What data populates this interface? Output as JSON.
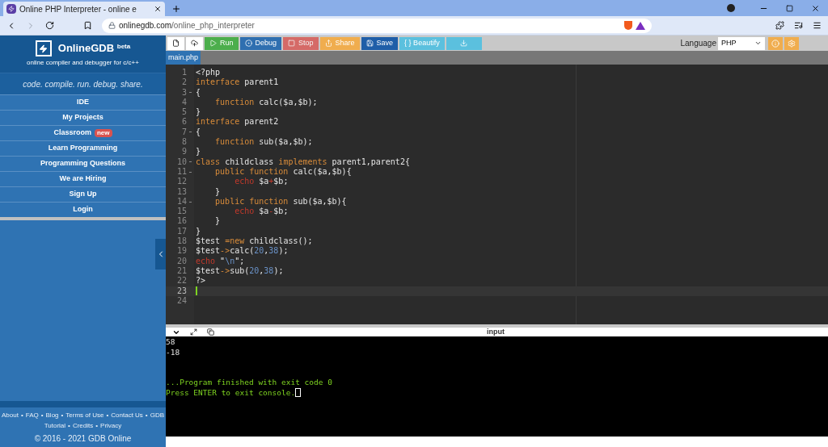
{
  "browser": {
    "tab_title": "Online PHP Interpreter - online e",
    "url_domain": "onlinegdb.com",
    "url_path": "/online_php_interpreter"
  },
  "sidebar": {
    "brand": "OnlineGDB",
    "brand_tag": "beta",
    "subtitle": "online compiler and debugger for c/c++",
    "tagline": "code. compile. run. debug. share.",
    "menu": [
      {
        "label": "IDE"
      },
      {
        "label": "My Projects"
      },
      {
        "label": "Classroom",
        "badge": "new"
      },
      {
        "label": "Learn Programming"
      },
      {
        "label": "Programming Questions"
      },
      {
        "label": "We are Hiring"
      },
      {
        "label": "Sign Up"
      },
      {
        "label": "Login"
      }
    ],
    "footer_separator": "•",
    "footer_rows": [
      [
        "About",
        "FAQ",
        "Blog",
        "Terms of Use",
        "Contact Us",
        "GDB"
      ],
      [
        "Tutorial",
        "Credits",
        "Privacy"
      ]
    ],
    "copyright": "© 2016 - 2021 GDB Online"
  },
  "toolbar": {
    "buttons": [
      {
        "kind": "new",
        "disabled": false
      },
      {
        "kind": "upload",
        "disabled": false
      },
      {
        "kind": "run",
        "label": "Run",
        "disabled": false
      },
      {
        "kind": "debug",
        "label": "Debug",
        "disabled": false
      },
      {
        "kind": "stop",
        "label": "Stop",
        "disabled": true
      },
      {
        "kind": "share",
        "label": "Share",
        "disabled": false
      },
      {
        "kind": "save",
        "label": "Save",
        "disabled": false
      },
      {
        "kind": "beautify",
        "label": "{ } Beautify",
        "disabled": false
      },
      {
        "kind": "download",
        "disabled": false
      }
    ],
    "language_label": "Language",
    "language": "PHP"
  },
  "file_tabs": [
    {
      "label": "main.php",
      "selected": true
    }
  ],
  "editor": {
    "lines": [
      {
        "number": "1",
        "foldable": false,
        "active": false,
        "tokens": [
          {
            "text": "<?php",
            "kind": "plain"
          }
        ]
      },
      {
        "number": "2",
        "foldable": false,
        "active": false,
        "tokens": [
          {
            "text": "interface",
            "kind": "keyword"
          },
          {
            "text": " parent1",
            "kind": "plain"
          }
        ]
      },
      {
        "number": "3",
        "foldable": true,
        "active": false,
        "tokens": [
          {
            "text": "{",
            "kind": "plain"
          }
        ]
      },
      {
        "number": "4",
        "foldable": false,
        "active": false,
        "tokens": [
          {
            "text": "    function",
            "kind": "keyword"
          },
          {
            "text": " calc($a,$b);",
            "kind": "plain"
          }
        ]
      },
      {
        "number": "5",
        "foldable": false,
        "active": false,
        "tokens": [
          {
            "text": "}",
            "kind": "plain"
          }
        ]
      },
      {
        "number": "6",
        "foldable": false,
        "active": false,
        "tokens": [
          {
            "text": "interface",
            "kind": "keyword"
          },
          {
            "text": " parent2",
            "kind": "plain"
          }
        ]
      },
      {
        "number": "7",
        "foldable": true,
        "active": false,
        "tokens": [
          {
            "text": "{",
            "kind": "plain"
          }
        ]
      },
      {
        "number": "8",
        "foldable": false,
        "active": false,
        "tokens": [
          {
            "text": "    function",
            "kind": "keyword"
          },
          {
            "text": " sub($a,$b);",
            "kind": "plain"
          }
        ]
      },
      {
        "number": "9",
        "foldable": false,
        "active": false,
        "tokens": [
          {
            "text": "}",
            "kind": "plain"
          }
        ]
      },
      {
        "number": "10",
        "foldable": true,
        "active": false,
        "tokens": [
          {
            "text": "class",
            "kind": "keyword"
          },
          {
            "text": " childclass ",
            "kind": "plain"
          },
          {
            "text": "implements",
            "kind": "keyword"
          },
          {
            "text": " parent1,parent2{",
            "kind": "plain"
          }
        ]
      },
      {
        "number": "11",
        "foldable": true,
        "active": false,
        "tokens": [
          {
            "text": "    public function",
            "kind": "keyword"
          },
          {
            "text": " calc($a,$b){",
            "kind": "plain"
          }
        ]
      },
      {
        "number": "12",
        "foldable": false,
        "active": false,
        "tokens": [
          {
            "text": "        echo",
            "kind": "builtin"
          },
          {
            "text": " $a",
            "kind": "plain"
          },
          {
            "text": "+",
            "kind": "builtin"
          },
          {
            "text": "$b;",
            "kind": "plain"
          }
        ]
      },
      {
        "number": "13",
        "foldable": false,
        "active": false,
        "tokens": [
          {
            "text": "    }",
            "kind": "plain"
          }
        ]
      },
      {
        "number": "14",
        "foldable": true,
        "active": false,
        "tokens": [
          {
            "text": "    public function",
            "kind": "keyword"
          },
          {
            "text": " sub($a,$b){",
            "kind": "plain"
          }
        ]
      },
      {
        "number": "15",
        "foldable": false,
        "active": false,
        "tokens": [
          {
            "text": "        echo",
            "kind": "builtin"
          },
          {
            "text": " $a",
            "kind": "plain"
          },
          {
            "text": "-",
            "kind": "builtin"
          },
          {
            "text": "$b;",
            "kind": "plain"
          }
        ]
      },
      {
        "number": "16",
        "foldable": false,
        "active": false,
        "tokens": [
          {
            "text": "    }",
            "kind": "plain"
          }
        ]
      },
      {
        "number": "17",
        "foldable": false,
        "active": false,
        "tokens": [
          {
            "text": "}",
            "kind": "plain"
          }
        ]
      },
      {
        "number": "18",
        "foldable": false,
        "active": false,
        "tokens": [
          {
            "text": "$test ",
            "kind": "plain"
          },
          {
            "text": "=new",
            "kind": "keyword"
          },
          {
            "text": " childclass();",
            "kind": "plain"
          }
        ]
      },
      {
        "number": "19",
        "foldable": false,
        "active": false,
        "tokens": [
          {
            "text": "$test",
            "kind": "plain"
          },
          {
            "text": "->",
            "kind": "keyword"
          },
          {
            "text": "calc(",
            "kind": "plain"
          },
          {
            "text": "20",
            "kind": "number"
          },
          {
            "text": ",",
            "kind": "plain"
          },
          {
            "text": "38",
            "kind": "number"
          },
          {
            "text": ");",
            "kind": "plain"
          }
        ]
      },
      {
        "number": "20",
        "foldable": false,
        "active": false,
        "tokens": [
          {
            "text": "echo",
            "kind": "builtin"
          },
          {
            "text": " \"",
            "kind": "plain"
          },
          {
            "text": "\\n",
            "kind": "number"
          },
          {
            "text": "\";",
            "kind": "plain"
          }
        ]
      },
      {
        "number": "21",
        "foldable": false,
        "active": false,
        "tokens": [
          {
            "text": "$test",
            "kind": "plain"
          },
          {
            "text": "->",
            "kind": "keyword"
          },
          {
            "text": "sub(",
            "kind": "plain"
          },
          {
            "text": "20",
            "kind": "number"
          },
          {
            "text": ",",
            "kind": "plain"
          },
          {
            "text": "38",
            "kind": "number"
          },
          {
            "text": ");",
            "kind": "plain"
          }
        ]
      },
      {
        "number": "22",
        "foldable": false,
        "active": false,
        "tokens": [
          {
            "text": "?>",
            "kind": "plain"
          }
        ]
      },
      {
        "number": "23",
        "foldable": false,
        "active": true
      },
      {
        "number": "24",
        "foldable": false,
        "active": false
      }
    ]
  },
  "output": {
    "input_label": "input",
    "cursor": true,
    "lines": [
      "58",
      "-18"
    ],
    "status_lines": [
      "...Program finished with exit code 0",
      "Press ENTER to exit console."
    ]
  }
}
